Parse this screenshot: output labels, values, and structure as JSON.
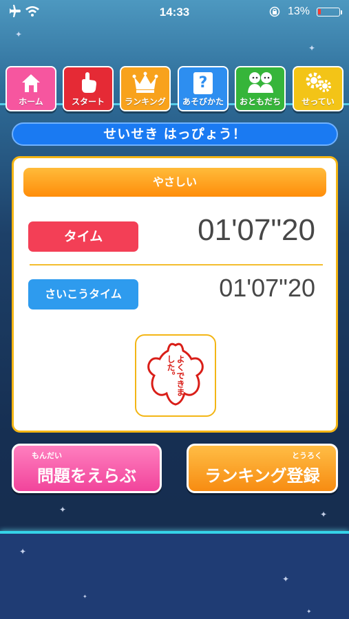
{
  "status_bar": {
    "time": "14:33",
    "battery_percent": "13%",
    "battery_level": 0.13
  },
  "nav": {
    "items": [
      {
        "label": "ホーム",
        "color": "#f6569f"
      },
      {
        "label": "スタート",
        "color": "#e52a35"
      },
      {
        "label": "ランキング",
        "color": "#f8a21c"
      },
      {
        "label": "あそびかた",
        "color": "#2d8ef0"
      },
      {
        "label": "おともだち",
        "color": "#36b53a"
      },
      {
        "label": "せってい",
        "color": "#f3c417"
      }
    ],
    "help_glyph": "?"
  },
  "title_banner": {
    "text": "せいせき はっぴょう！"
  },
  "result": {
    "difficulty": "やさしい",
    "time_label": "タイム",
    "time_value": "01'07\"20",
    "best_label": "さいこうタイム",
    "best_value": "01'07\"20",
    "stamp_text": "よくできました。"
  },
  "actions": {
    "select_ruby": "もんだい",
    "select_label": "問題をえらぶ",
    "ranking_ruby": "とうろく",
    "ranking_label": "ランキング登録"
  },
  "colors": {
    "accent_blue": "#1a7af2",
    "card_border": "#f3b514",
    "time_red": "#f33f56",
    "best_blue": "#2e9bee",
    "pink": "#f6569f",
    "orange": "#f8a21c"
  }
}
